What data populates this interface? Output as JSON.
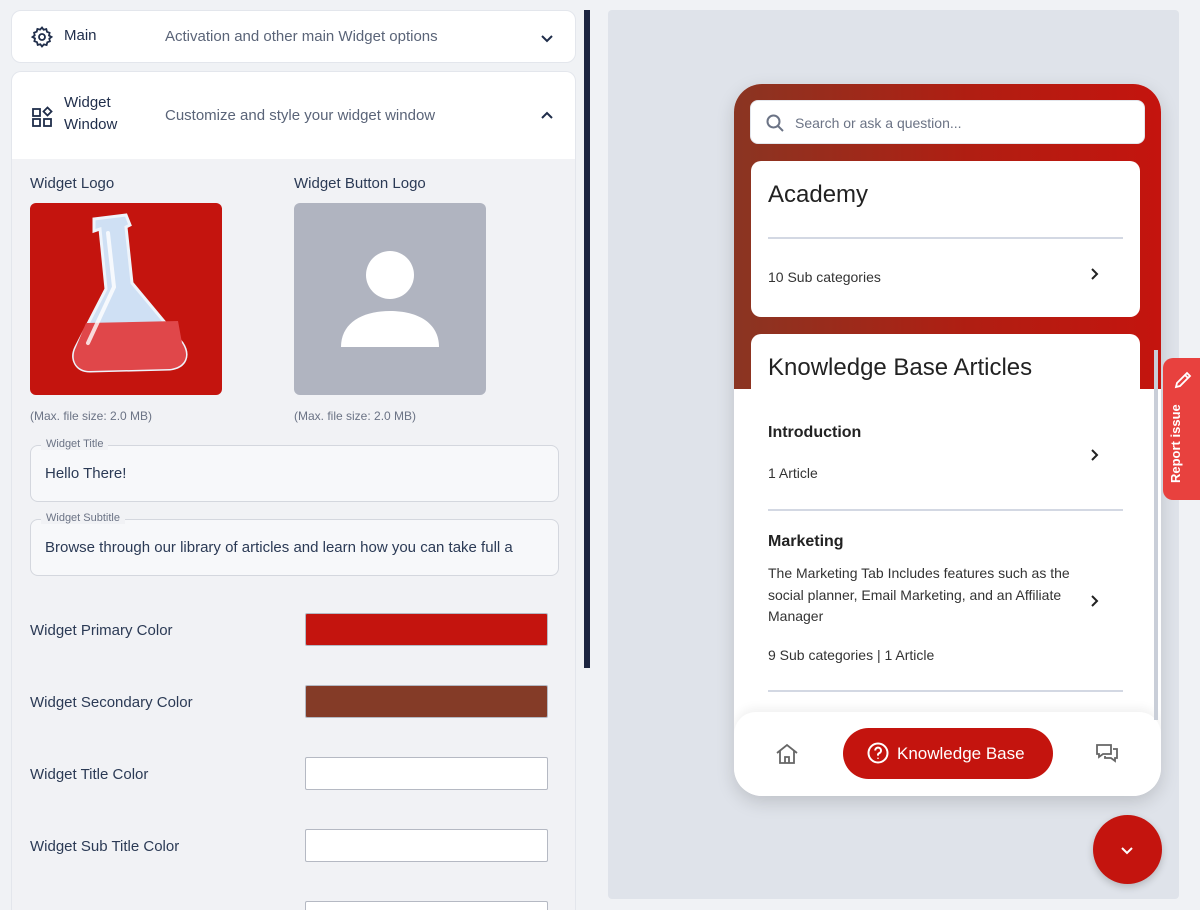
{
  "sections": {
    "main": {
      "title": "Main",
      "description": "Activation and other main Widget options",
      "expanded": false
    },
    "widget_window": {
      "title": "Widget Window",
      "description": "Customize and style your widget window",
      "expanded": true
    }
  },
  "logos": {
    "widget_logo_label": "Widget Logo",
    "widget_button_logo_label": "Widget Button Logo",
    "max_size_hint": "(Max. file size: 2.0 MB)"
  },
  "fields": {
    "title": {
      "legend": "Widget Title",
      "value": "Hello There!"
    },
    "subtitle": {
      "legend": "Widget Subtitle",
      "value": "Browse through our library of articles and learn how you can take full a"
    }
  },
  "colors": {
    "primary": {
      "label": "Widget Primary Color",
      "value": "#c4140e"
    },
    "secondary": {
      "label": "Widget Secondary Color",
      "value": "#843b27"
    },
    "title_color": {
      "label": "Widget Title Color",
      "value": "#ffffff"
    },
    "subtitle_color": {
      "label": "Widget Sub Title Color",
      "value": "#ffffff"
    }
  },
  "preview": {
    "search_placeholder": "Search or ask a question...",
    "academy": {
      "title": "Academy",
      "meta": "10 Sub categories"
    },
    "articles": {
      "title": "Knowledge Base Articles",
      "items": [
        {
          "title": "Introduction",
          "description": "",
          "meta": "1 Article"
        },
        {
          "title": "Marketing",
          "description": "The Marketing Tab Includes features such as the social planner, Email Marketing, and an Affiliate Manager",
          "meta": "9 Sub categories | 1 Article"
        }
      ]
    },
    "nav": {
      "knowledge_base_label": "Knowledge Base"
    }
  },
  "report_issue": "Report issue",
  "icons": [
    "gear-icon",
    "widgets-icon",
    "chevron-down-icon",
    "chevron-up-icon",
    "flask-icon",
    "user-placeholder-icon",
    "search-icon",
    "chevron-right-icon",
    "home-icon",
    "question-circle-icon",
    "chat-icon",
    "pencil-icon"
  ]
}
